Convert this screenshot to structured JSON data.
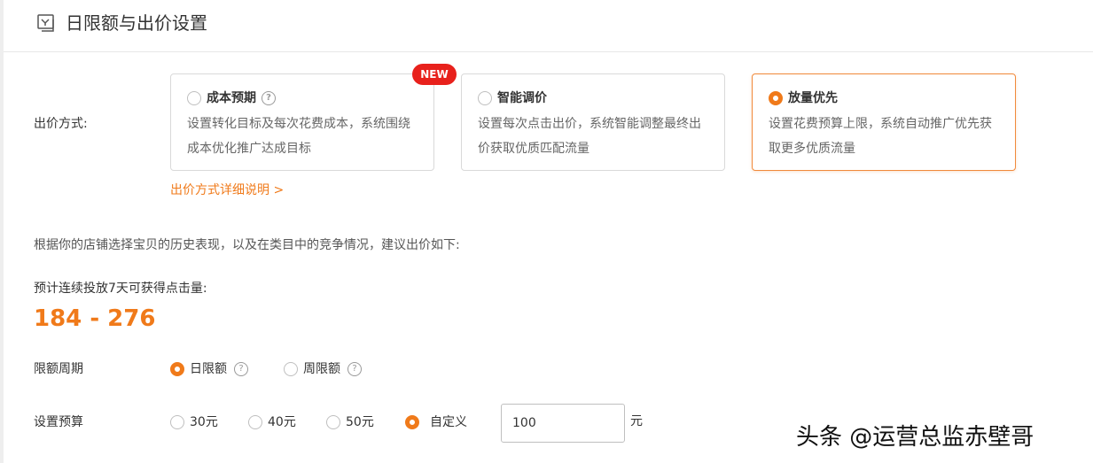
{
  "header": {
    "title": "日限额与出价设置",
    "icon": "calendar-icon"
  },
  "bid_method": {
    "label": "出价方式:",
    "options": [
      {
        "title": "成本预期",
        "desc": "设置转化目标及每次花费成本，系统围绕成本优化推广达成目标",
        "selected": false,
        "has_help": true,
        "badge": "NEW"
      },
      {
        "title": "智能调价",
        "desc": "设置每次点击出价，系统智能调整最终出价获取优质匹配流量",
        "selected": false,
        "has_help": false
      },
      {
        "title": "放量优先",
        "desc": "设置花费预算上限，系统自动推广优先获取更多优质流量",
        "selected": true,
        "has_help": false
      }
    ],
    "detail_link": "出价方式详细说明 >"
  },
  "suggestion_text": "根据你的店铺选择宝贝的历史表现，以及在类目中的竞争情况，建议出价如下:",
  "forecast": {
    "label": "预计连续投放7天可获得点击量:",
    "value": "184 - 276"
  },
  "limit_period": {
    "label": "限额周期",
    "options": [
      {
        "label": "日限额",
        "selected": true
      },
      {
        "label": "周限额",
        "selected": false
      }
    ]
  },
  "budget": {
    "label": "设置预算",
    "options": [
      {
        "label": "30元",
        "selected": false
      },
      {
        "label": "40元",
        "selected": false
      },
      {
        "label": "50元",
        "selected": false
      },
      {
        "label": "自定义",
        "selected": true
      }
    ],
    "custom_value": "100",
    "unit": "元"
  },
  "watermark": "头条 @运营总监赤壁哥",
  "colors": {
    "accent": "#f07a1a",
    "badge": "#e8211c",
    "border": "#d9d9d9"
  }
}
